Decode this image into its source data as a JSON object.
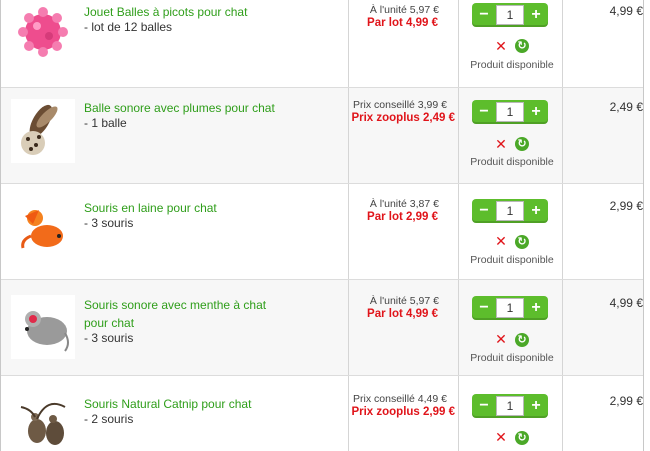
{
  "items": [
    {
      "title": "Jouet Balles à picots pour chat",
      "title2": "",
      "sub": "- lot de 12 balles",
      "price_small": "À l'unité 5,97 €",
      "price_big": "Par lot 4,99 €",
      "qty": "1",
      "availability": "Produit disponible",
      "total": "4,99 €",
      "image_icon": "spiky-pink-ball-icon"
    },
    {
      "title": "Balle sonore avec plumes pour chat",
      "title2": "",
      "sub": "- 1 balle",
      "price_small": "Prix conseillé 3,99 €",
      "price_big": "Prix zooplus 2,49 €",
      "qty": "1",
      "availability": "Produit disponible",
      "total": "2,49 €",
      "image_icon": "feather-ball-icon"
    },
    {
      "title": "Souris en laine pour chat",
      "title2": "",
      "sub": "- 3 souris",
      "price_small": "À l'unité 3,87 €",
      "price_big": "Par lot 2,99 €",
      "qty": "1",
      "availability": "Produit disponible",
      "total": "2,99 €",
      "image_icon": "orange-wool-mouse-icon"
    },
    {
      "title": "Souris sonore avec menthe à chat",
      "title2": "pour chat",
      "sub": "- 3 souris",
      "price_small": "À l'unité 5,97 €",
      "price_big": "Par lot 4,99 €",
      "qty": "1",
      "availability": "Produit disponible",
      "total": "4,99 €",
      "image_icon": "grey-plush-mouse-icon"
    },
    {
      "title": "Souris Natural Catnip pour chat",
      "title2": "",
      "sub": "- 2 souris",
      "price_small": "Prix conseillé 4,49 €",
      "price_big": "Prix zooplus 2,99 €",
      "qty": "1",
      "availability": "",
      "total": "2,99 €",
      "image_icon": "natural-catnip-mice-icon"
    }
  ],
  "icons": {
    "minus": "minus-icon",
    "plus": "plus-icon",
    "delete": "delete-x-icon",
    "refresh": "refresh-icon"
  },
  "colors": {
    "link_green": "#2f9e1a",
    "price_red": "#e0141a",
    "button_green": "#5dbd2c"
  }
}
